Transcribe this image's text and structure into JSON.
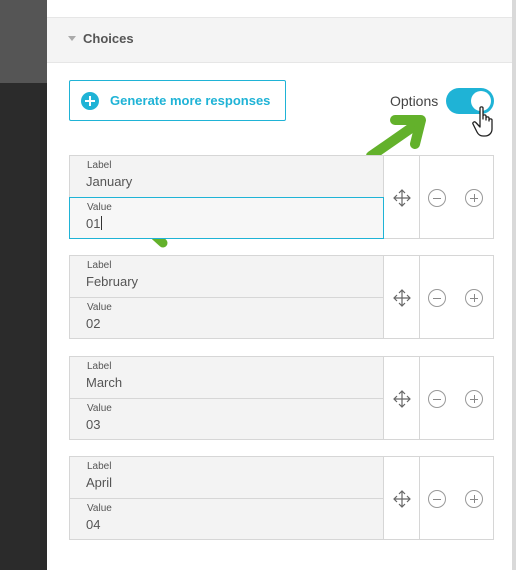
{
  "section": {
    "title": "Choices"
  },
  "toolbar": {
    "generate_label": "Generate more responses",
    "options_label": "Options",
    "options_on": true
  },
  "choices": [
    {
      "label_caption": "Label",
      "label": "January",
      "value_caption": "Value",
      "value": "01"
    },
    {
      "label_caption": "Label",
      "label": "February",
      "value_caption": "Value",
      "value": "02"
    },
    {
      "label_caption": "Label",
      "label": "March",
      "value_caption": "Value",
      "value": "03"
    },
    {
      "label_caption": "Label",
      "label": "April",
      "value_caption": "Value",
      "value": "04"
    }
  ],
  "colors": {
    "accent": "#1fb3d6",
    "annotation_arrow": "#63b12b"
  }
}
